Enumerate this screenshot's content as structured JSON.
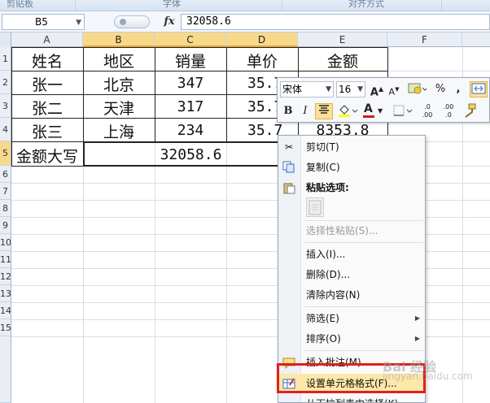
{
  "ribbon": {
    "groups": [
      "剪贴板",
      "字体",
      "对齐方式"
    ]
  },
  "formula_bar": {
    "name_box": "B5",
    "fx_label": "fx",
    "formula_value": "32058.6"
  },
  "columns": [
    "A",
    "B",
    "C",
    "D",
    "E",
    "F"
  ],
  "rows": [
    "1",
    "2",
    "3",
    "4",
    "5",
    "6",
    "7",
    "8",
    "9",
    "10",
    "11",
    "12",
    "13",
    "14",
    "15"
  ],
  "table": {
    "headers": [
      "姓名",
      "地区",
      "销量",
      "单价",
      "金额"
    ],
    "rows": [
      [
        "张一",
        "北京",
        "347",
        "35.7",
        ""
      ],
      [
        "张二",
        "天津",
        "317",
        "35.7",
        ""
      ],
      [
        "张三",
        "上海",
        "234",
        "35.7",
        "8353.8"
      ]
    ],
    "total_label": "金额大写",
    "total_value": "32058.6"
  },
  "mini_toolbar": {
    "font": "宋体",
    "size": "16",
    "grow_font": "A",
    "shrink_font": "A",
    "percent": "%",
    "comma": ",",
    "bold": "B",
    "italic": "I",
    "font_color_letter": "A",
    "inc_decimal": ".0 .00",
    "dec_decimal": ".00 .0",
    "highlight_color": "#ffff00",
    "font_color": "#d01c1c"
  },
  "context_menu": {
    "items": [
      {
        "label": "剪切(T)",
        "icon": "scissors-icon"
      },
      {
        "label": "复制(C)",
        "icon": "copy-icon"
      },
      {
        "label": "粘贴选项:",
        "icon": "paste-icon"
      },
      {
        "label": "选择性粘贴(S)...",
        "icon": ""
      },
      {
        "label": "插入(I)...",
        "icon": ""
      },
      {
        "label": "删除(D)...",
        "icon": ""
      },
      {
        "label": "清除内容(N)",
        "icon": ""
      },
      {
        "label": "筛选(E)",
        "icon": ""
      },
      {
        "label": "排序(O)",
        "icon": ""
      },
      {
        "label": "插入批注(M)",
        "icon": "comment-icon"
      },
      {
        "label": "设置单元格格式(F)...",
        "icon": "format-cells-icon"
      },
      {
        "label": "从下拉列表中选择(K)...",
        "icon": ""
      }
    ]
  },
  "watermark": {
    "text": "Bai 经验",
    "sub": "jingyan.baidu.com"
  }
}
